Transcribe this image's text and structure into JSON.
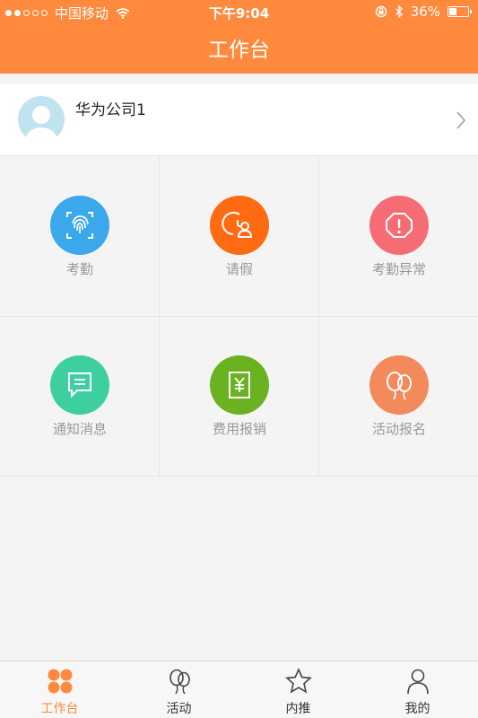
{
  "status_bar": {
    "carrier": "中国移动",
    "time": "下午9:04",
    "battery": "36%",
    "battery_level": 0.36
  },
  "header": {
    "title": "工作台"
  },
  "company": {
    "name": "华为公司1"
  },
  "grid": [
    {
      "label": "考勤",
      "color": "#3aa8ea",
      "icon": "fingerprint-icon"
    },
    {
      "label": "请假",
      "color": "#ff6a13",
      "icon": "leave-icon"
    },
    {
      "label": "考勤异常",
      "color": "#f56c75",
      "icon": "alert-icon"
    },
    {
      "label": "通知消息",
      "color": "#3ecfa0",
      "icon": "message-icon"
    },
    {
      "label": "费用报销",
      "color": "#6ab21f",
      "icon": "yen-icon"
    },
    {
      "label": "活动报名",
      "color": "#f28a5c",
      "icon": "balloon-icon"
    }
  ],
  "tabs": [
    {
      "label": "工作台",
      "active": true,
      "icon": "grid-icon"
    },
    {
      "label": "活动",
      "active": false,
      "icon": "balloon-icon"
    },
    {
      "label": "内推",
      "active": false,
      "icon": "star-icon"
    },
    {
      "label": "我的",
      "active": false,
      "icon": "person-icon"
    }
  ],
  "colors": {
    "accent": "#ff8a3d"
  }
}
